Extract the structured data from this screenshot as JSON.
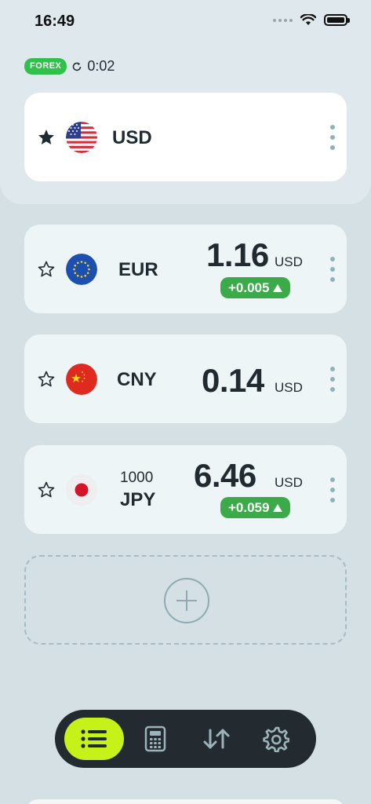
{
  "status_bar": {
    "time": "16:49"
  },
  "market": {
    "badge": "FOREX",
    "timer": "0:02"
  },
  "base_currency": {
    "code": "USD",
    "favorite": true
  },
  "rates": [
    {
      "code": "EUR",
      "value": "1.16",
      "unit": "USD",
      "change": "+0.005",
      "favorite": false
    },
    {
      "code": "CNY",
      "value": "0.14",
      "unit": "USD",
      "change": "",
      "favorite": false
    },
    {
      "amount": "1000",
      "code": "JPY",
      "value": "6.46",
      "unit": "USD",
      "change": "+0.059",
      "favorite": false
    }
  ],
  "tabs": [
    {
      "icon": "list-icon",
      "active": true
    },
    {
      "icon": "calculator-icon",
      "active": false
    },
    {
      "icon": "swap-arrows-icon",
      "active": false
    },
    {
      "icon": "gear-icon",
      "active": false
    }
  ],
  "colors": {
    "accent": "#c6f21a",
    "positive": "#3aab48",
    "badge": "#2fc14a",
    "tabbar": "#232b30"
  }
}
